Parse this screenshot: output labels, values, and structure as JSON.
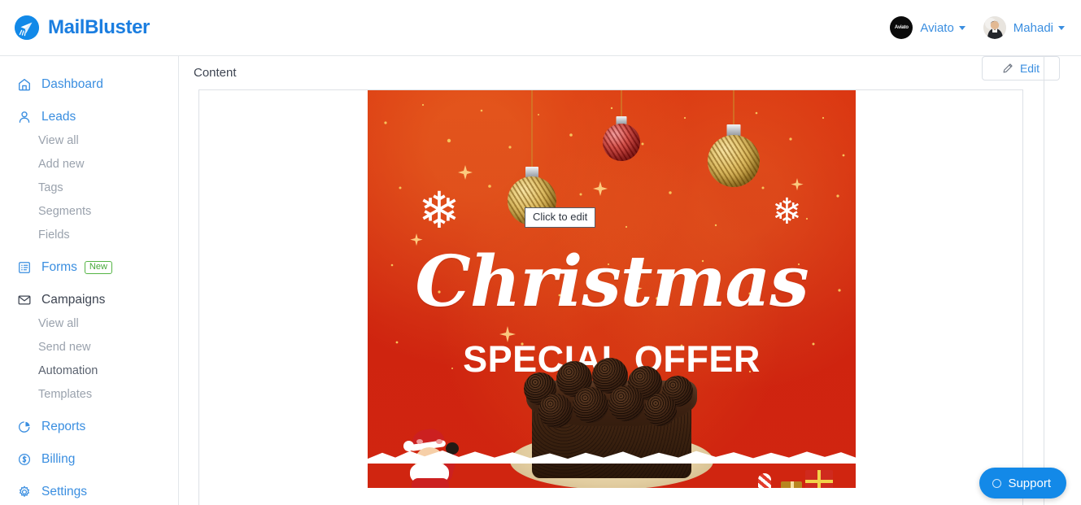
{
  "app": {
    "brand_name": "MailBluster",
    "brand_icon": "paper-plane-logo-icon"
  },
  "topbar": {
    "accounts": [
      {
        "label": "Aviato",
        "avatar_icon": "aviato-logo-avatar",
        "avatar_text": "Aviato",
        "caret_icon": "chevron-down-icon"
      },
      {
        "label": "Mahadi",
        "avatar_icon": "user-photo-avatar",
        "caret_icon": "chevron-down-icon"
      }
    ]
  },
  "sidebar": {
    "groups": [
      {
        "label": "Dashboard",
        "icon": "home-icon",
        "children": []
      },
      {
        "label": "Leads",
        "icon": "user-icon",
        "children": [
          {
            "label": "View all"
          },
          {
            "label": "Add new"
          },
          {
            "label": "Tags"
          },
          {
            "label": "Segments"
          },
          {
            "label": "Fields"
          }
        ]
      },
      {
        "label": "Forms",
        "icon": "form-list-icon",
        "badge": "New",
        "children": []
      },
      {
        "label": "Campaigns",
        "icon": "envelope-icon",
        "children": [
          {
            "label": "View all"
          },
          {
            "label": "Send new"
          },
          {
            "label": "Automation"
          },
          {
            "label": "Templates"
          }
        ]
      },
      {
        "label": "Reports",
        "icon": "pie-chart-icon",
        "children": []
      },
      {
        "label": "Billing",
        "icon": "dollar-circle-icon",
        "children": []
      },
      {
        "label": "Settings",
        "icon": "gear-icon",
        "children": []
      }
    ]
  },
  "main": {
    "section_title": "Content",
    "edit_button": {
      "label": "Edit",
      "icon": "pencil-icon"
    },
    "editor_tooltip": "Click to edit",
    "email_banner": {
      "headline_script": "Christmas",
      "headline_sub": "SPECIAL OFFER",
      "background_color": "#d42a12",
      "decorations": [
        "gold-ornament",
        "red-ornament",
        "gold-ornament",
        "snowflake",
        "snowflake",
        "santa-claus",
        "chocolate-truffle-cake",
        "gift-boxes",
        "candy-cane",
        "snow-ground"
      ]
    }
  },
  "support": {
    "label": "Support",
    "icon": "lifebuoy-icon"
  },
  "colors": {
    "brand_blue": "#1b7ee0",
    "link_blue": "#3a8ee0",
    "badge_green": "#46a838",
    "banner_red": "#d42a12",
    "support_blue": "#1389e8",
    "muted_text": "#9aa2ad"
  }
}
